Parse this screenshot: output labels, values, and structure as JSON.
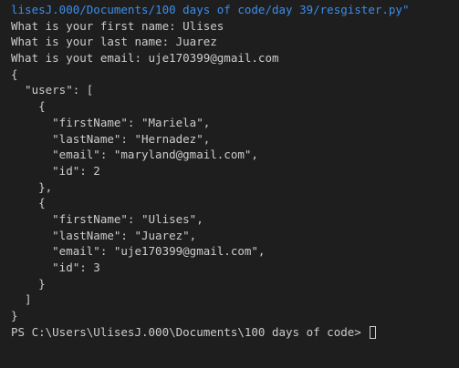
{
  "terminal": {
    "lines": [
      "lisesJ.000/Documents/100 days of code/day 39/resgister.py\"",
      "What is your first name: Ulises",
      "What is your last name: Juarez",
      "What is yout email: uje170399@gmail.com",
      "{",
      "  \"users\": [",
      "    {",
      "      \"firstName\": \"Mariela\",",
      "      \"lastName\": \"Hernadez\",",
      "      \"email\": \"maryland@gmail.com\",",
      "      \"id\": 2",
      "    },",
      "    {",
      "      \"firstName\": \"Ulises\",",
      "      \"lastName\": \"Juarez\",",
      "      \"email\": \"uje170399@gmail.com\",",
      "      \"id\": 3",
      "    }",
      "  ]",
      "}"
    ],
    "prompt": "PS C:\\Users\\UlisesJ.000\\Documents\\100 days of code> "
  },
  "colors": {
    "background": "#1e1e1e",
    "text": "#cccccc",
    "path_link": "#3b8eea"
  }
}
